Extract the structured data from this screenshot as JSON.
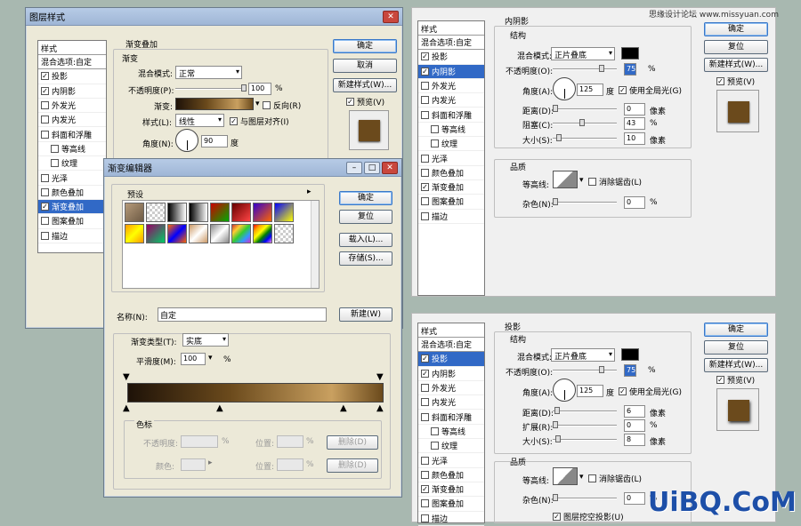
{
  "layer_style_dialog": {
    "title": "图层样式",
    "styles_header": "样式",
    "blend_options": "混合选项:自定",
    "items": [
      {
        "label": "投影",
        "checked": true
      },
      {
        "label": "内阴影",
        "checked": true
      },
      {
        "label": "外发光",
        "checked": false
      },
      {
        "label": "内发光",
        "checked": false
      },
      {
        "label": "斜面和浮雕",
        "checked": false
      },
      {
        "label": "等高线",
        "checked": false,
        "indent": true
      },
      {
        "label": "纹理",
        "checked": false,
        "indent": true
      },
      {
        "label": "光泽",
        "checked": false
      },
      {
        "label": "颜色叠加",
        "checked": false
      },
      {
        "label": "渐变叠加",
        "checked": true,
        "selected": true
      },
      {
        "label": "图案叠加",
        "checked": false
      },
      {
        "label": "描边",
        "checked": false
      }
    ],
    "section_title": "渐变叠加",
    "group_title": "渐变",
    "blend_mode_label": "混合模式:",
    "blend_mode_value": "正常",
    "opacity_label": "不透明度(P):",
    "opacity_value": "100",
    "opacity_unit": "%",
    "opacity_level": 1.0,
    "gradient_label": "渐变:",
    "reverse_label": "反向(R)",
    "style_label": "样式(L):",
    "style_value": "线性",
    "align_label": "与图层对齐(I)",
    "angle_label": "角度(N):",
    "angle_value": "90",
    "angle_unit": "度",
    "ok": "确定",
    "cancel": "取消",
    "new_style": "新建样式(W)...",
    "preview": "预览(V)"
  },
  "gradient_editor": {
    "title": "渐变编辑器",
    "presets_label": "预设",
    "ok": "确定",
    "reset": "复位",
    "load": "载入(L)...",
    "save": "存储(S)...",
    "name_label": "名称(N):",
    "name_value": "自定",
    "new_button": "新建(W)",
    "type_label": "渐变类型(T):",
    "type_value": "实底",
    "smooth_label": "平滑度(M):",
    "smooth_value": "100",
    "smooth_unit": "%",
    "stops_title": "色标",
    "stop_opacity_label": "不透明度:",
    "stop_opacity_unit": "%",
    "location_label": "位置:",
    "location_unit": "%",
    "delete": "删除(D)",
    "color_label": "颜色:"
  },
  "inner_shadow_panel": {
    "section_title": "内阴影",
    "structure": "结构",
    "styles_header": "样式",
    "blend_options": "混合选项:自定",
    "items": [
      {
        "label": "投影",
        "checked": true
      },
      {
        "label": "内阴影",
        "checked": true,
        "selected": true
      },
      {
        "label": "外发光",
        "checked": false
      },
      {
        "label": "内发光",
        "checked": false
      },
      {
        "label": "斜面和浮雕",
        "checked": false
      },
      {
        "label": "等高线",
        "checked": false,
        "indent": true
      },
      {
        "label": "纹理",
        "checked": false,
        "indent": true
      },
      {
        "label": "光泽",
        "checked": false
      },
      {
        "label": "颜色叠加",
        "checked": false
      },
      {
        "label": "渐变叠加",
        "checked": true
      },
      {
        "label": "图案叠加",
        "checked": false
      },
      {
        "label": "描边",
        "checked": false
      }
    ],
    "blend_mode_label": "混合模式:",
    "blend_mode_value": "正片叠底",
    "opacity_label": "不透明度(O):",
    "opacity_value": "75",
    "opacity_unit": "%",
    "angle_label": "角度(A):",
    "angle_value": "125",
    "angle_unit": "度",
    "global_light": "使用全局光(G)",
    "distance_label": "距离(D):",
    "distance_value": "0",
    "distance_unit": "像素",
    "choke_label": "阻塞(C):",
    "choke_value": "43",
    "choke_unit": "%",
    "size_label": "大小(S):",
    "size_value": "10",
    "size_unit": "像素",
    "quality": "品质",
    "contour_label": "等高线:",
    "antialias": "消除锯齿(L)",
    "noise_label": "杂色(N):",
    "noise_value": "0",
    "noise_unit": "%",
    "ok": "确定",
    "reset": "复位",
    "new_style": "新建样式(W)...",
    "preview": "预览(V)"
  },
  "drop_shadow_panel": {
    "section_title": "投影",
    "structure": "结构",
    "styles_header": "样式",
    "blend_options": "混合选项:自定",
    "items": [
      {
        "label": "投影",
        "checked": true,
        "selected": true
      },
      {
        "label": "内阴影",
        "checked": true
      },
      {
        "label": "外发光",
        "checked": false
      },
      {
        "label": "内发光",
        "checked": false
      },
      {
        "label": "斜面和浮雕",
        "checked": false
      },
      {
        "label": "等高线",
        "checked": false,
        "indent": true
      },
      {
        "label": "纹理",
        "checked": false,
        "indent": true
      },
      {
        "label": "光泽",
        "checked": false
      },
      {
        "label": "颜色叠加",
        "checked": false
      },
      {
        "label": "渐变叠加",
        "checked": true
      },
      {
        "label": "图案叠加",
        "checked": false
      },
      {
        "label": "描边",
        "checked": false
      }
    ],
    "blend_mode_label": "混合模式:",
    "blend_mode_value": "正片叠底",
    "opacity_label": "不透明度(O):",
    "opacity_value": "75",
    "opacity_unit": "%",
    "angle_label": "角度(A):",
    "angle_value": "125",
    "angle_unit": "度",
    "global_light": "使用全局光(G)",
    "distance_label": "距离(D):",
    "distance_value": "6",
    "distance_unit": "像素",
    "spread_label": "扩展(R):",
    "spread_value": "0",
    "spread_unit": "%",
    "size_label": "大小(S):",
    "size_value": "8",
    "size_unit": "像素",
    "quality": "品质",
    "contour_label": "等高线:",
    "antialias": "消除锯齿(L)",
    "noise_label": "杂色(N):",
    "noise_value": "0",
    "noise_unit": "%",
    "knockout": "图层挖空投影(U)",
    "ok": "确定",
    "reset": "复位",
    "new_style": "新建样式(W)...",
    "preview": "预览(V)"
  },
  "watermark_top": "思缘设计论坛 www.missyuan.com",
  "watermark_logo": "UiBQ.CoM",
  "colors": {
    "gradient_dark": "#1e1208",
    "gradient_mid": "#6b4a1c",
    "gradient_light": "#c9a060",
    "accent": "#3169c6"
  }
}
